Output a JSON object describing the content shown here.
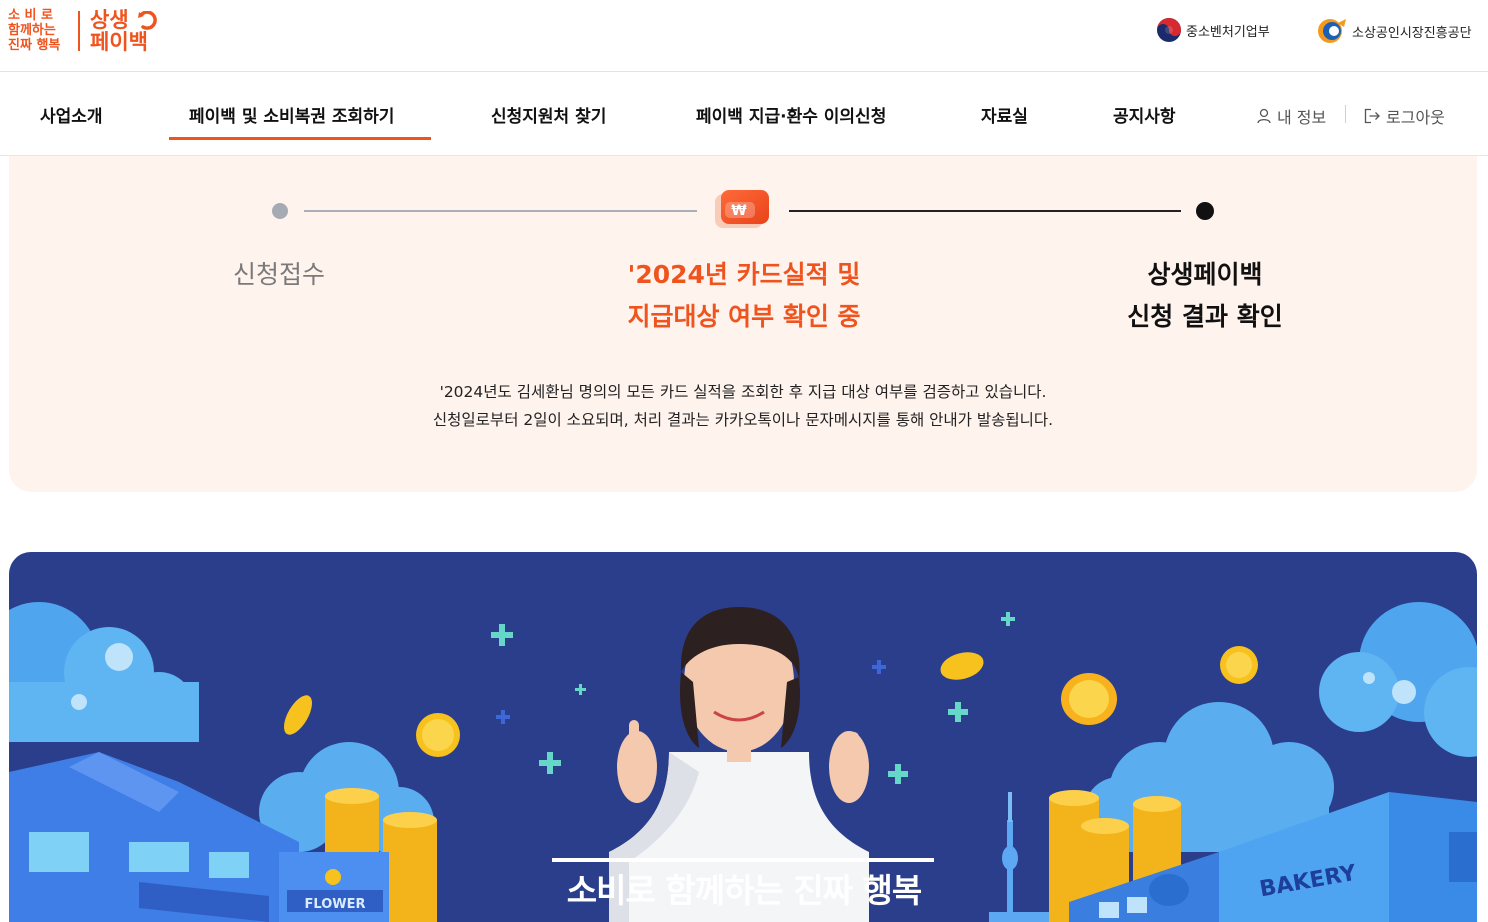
{
  "header": {
    "slogan_lines": [
      "소 비 로",
      "함께하는",
      "진짜 행복"
    ],
    "brand_lines": [
      "상생",
      "페이백"
    ],
    "orgs": [
      {
        "name": "중소벤처기업부",
        "icon": "taegeuk-emblem-icon"
      },
      {
        "name": "소상공인시장진흥공단",
        "icon": "semas-logo-icon"
      }
    ],
    "brand_color": "#f0541e"
  },
  "nav": {
    "items": [
      {
        "label": "사업소개",
        "active": false
      },
      {
        "label": "페이백 및 소비복권 조회하기",
        "active": true
      },
      {
        "label": "신청지원처 찾기",
        "active": false
      },
      {
        "label": "페이백 지급·환수 이의신청",
        "active": false
      },
      {
        "label": "자료실",
        "active": false
      },
      {
        "label": "공지사항",
        "active": false
      }
    ],
    "my_info": {
      "label": "내 정보",
      "icon": "user-icon"
    },
    "logout": {
      "label": "로그아웃",
      "icon": "logout-icon"
    }
  },
  "status": {
    "steps": [
      {
        "lines": [
          "신청접수"
        ],
        "state": "done"
      },
      {
        "lines": [
          "'2024년 카드실적 및",
          "지급대상 여부 확인 중"
        ],
        "state": "current",
        "icon": "won-card-icon"
      },
      {
        "lines": [
          "상생페이백",
          "신청 결과 확인"
        ],
        "state": "upcoming"
      }
    ],
    "notice_lines": [
      "'2024년도 김세환님 명의의 모든 카드 실적을 조회한 후 지급 대상 여부를 검증하고 있습니다.",
      "신청일로부터 2일이 소요되며, 처리 결과는 카카오톡이나 문자메시지를 통해 안내가 발송됩니다."
    ],
    "accent_color": "#f0541e",
    "panel_color": "#fff3ee"
  },
  "banner": {
    "title": "소비로 함께하는 진짜 행복",
    "signs": [
      "FLOWER",
      "BAKERY"
    ],
    "background_color": "#2a3e8c"
  }
}
